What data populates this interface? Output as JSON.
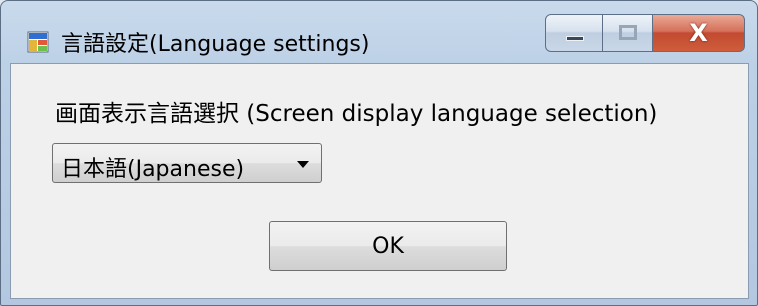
{
  "window": {
    "title": "言語設定(Language settings)",
    "icon": "app-window-icon",
    "caption_buttons": {
      "minimize_icon": "minimize-icon",
      "maximize_icon": "maximize-icon",
      "close_icon": "close-icon",
      "close_glyph": "X"
    }
  },
  "content": {
    "language_label": "画面表示言語選択 (Screen display language selection)",
    "language_select": {
      "selected": "日本語(Japanese)"
    },
    "ok_label": "OK"
  },
  "colors": {
    "client_background": "#f0f0f0",
    "close_button": "#c24a31",
    "titlebar": "#bcd0e6"
  }
}
